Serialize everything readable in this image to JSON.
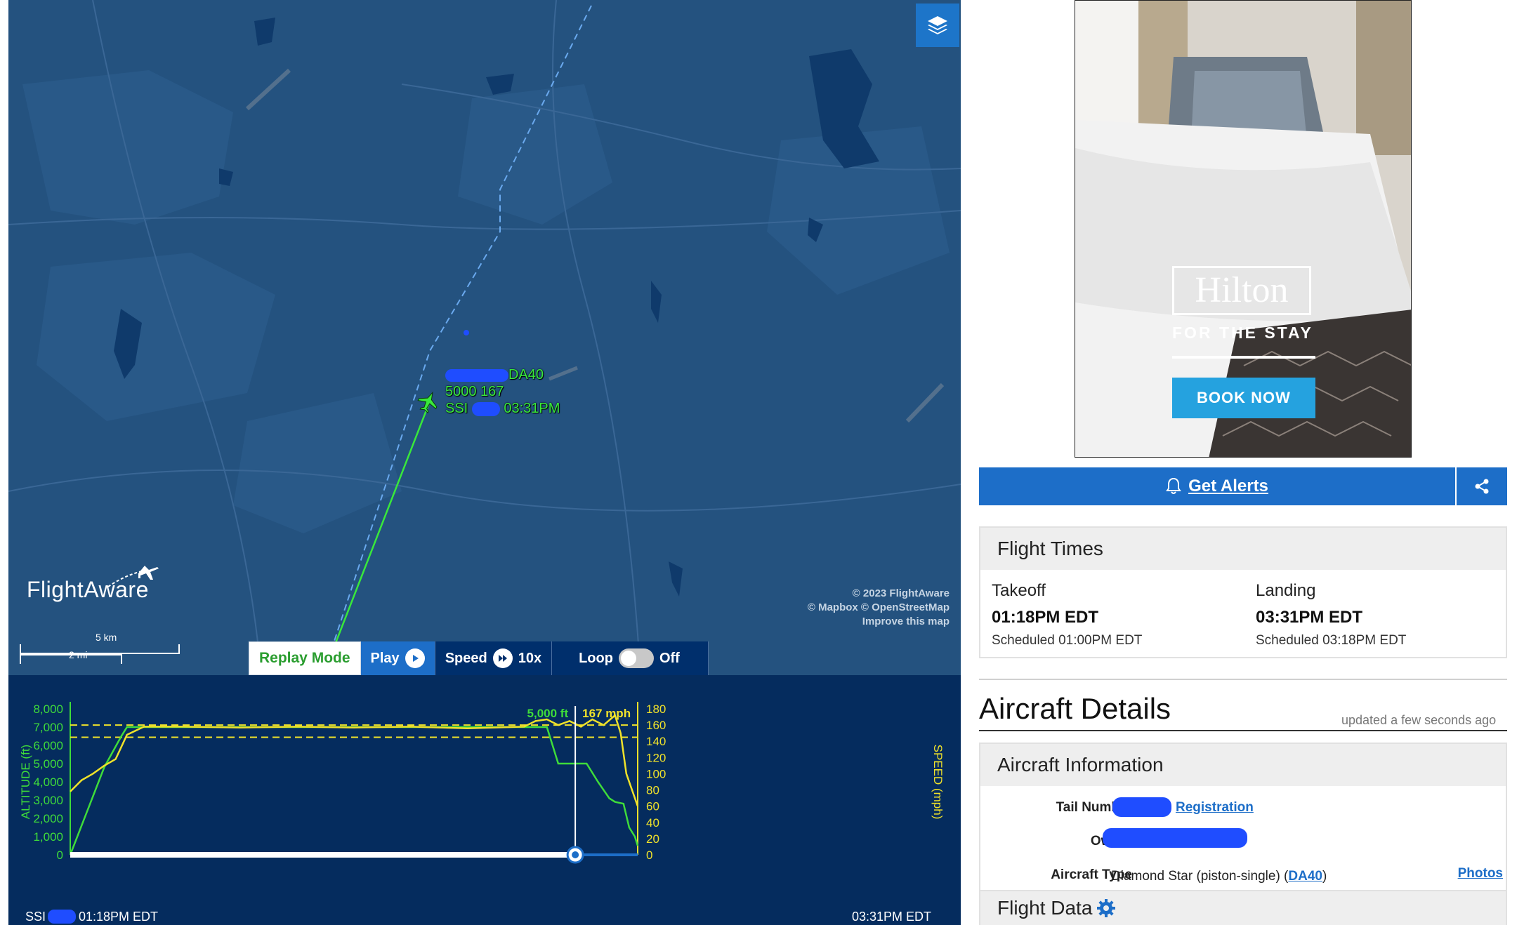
{
  "map": {
    "flight_label": {
      "line1_suffix": "DA40",
      "line2": "5000 167",
      "line3_prefix": "SSI",
      "line3_suffix": "03:31PM"
    },
    "logo_text": "FlightAware",
    "attribution": [
      "© 2023 FlightAware",
      "© Mapbox © OpenStreetMap",
      "Improve this map"
    ],
    "scale": {
      "km": "5 km",
      "mi": "2 mi"
    }
  },
  "replay": {
    "mode_label": "Replay Mode",
    "play_label": "Play",
    "speed_label": "Speed",
    "speed_value": "10x",
    "loop_label": "Loop",
    "loop_state": "Off"
  },
  "chart_data": {
    "type": "line",
    "readout_altitude": "5,000 ft",
    "readout_speed": "167 mph",
    "y_left_label": "ALTITUDE (ft)",
    "y_right_label": "SPEED (mph)",
    "y_left_ticks": [
      "8,000",
      "7,000",
      "6,000",
      "5,000",
      "4,000",
      "3,000",
      "2,000",
      "1,000",
      "0"
    ],
    "y_right_ticks": [
      "180",
      "160",
      "140",
      "120",
      "100",
      "80",
      "60",
      "40",
      "20",
      "0"
    ],
    "ylim_altitude": [
      0,
      8000
    ],
    "ylim_speed": [
      0,
      180
    ],
    "x_start_label_prefix": "SSI",
    "x_start_time": "01:18PM EDT",
    "x_end_time": "03:31PM EDT",
    "playhead_progress": 0.89,
    "series": [
      {
        "color": "#3fdc3a",
        "x": [
          0,
          0.03,
          0.06,
          0.09,
          0.1,
          0.84,
          0.86,
          0.88,
          0.91,
          0.93,
          0.95,
          0.96,
          0.975,
          0.985,
          0.995,
          1.0
        ],
        "values": [
          0,
          2400,
          4800,
          6500,
          7000,
          7000,
          5000,
          5000,
          5000,
          4000,
          3100,
          2900,
          2800,
          1500,
          1000,
          500
        ]
      },
      {
        "color": "#f0e22a",
        "x": [
          0,
          0.02,
          0.04,
          0.06,
          0.08,
          0.1,
          0.13,
          0.2,
          0.3,
          0.4,
          0.5,
          0.6,
          0.7,
          0.8,
          0.82,
          0.84,
          0.86,
          0.88,
          0.9,
          0.92,
          0.94,
          0.96,
          0.97,
          0.98,
          0.99,
          1.0
        ],
        "values": [
          78,
          92,
          100,
          110,
          118,
          148,
          158,
          158,
          157,
          158,
          157,
          158,
          156,
          158,
          165,
          167,
          160,
          165,
          158,
          167,
          160,
          172,
          150,
          100,
          80,
          60
        ]
      }
    ],
    "reference_lines": [
      160,
      145
    ]
  },
  "ad": {
    "brand": "Hilton",
    "tagline": "FOR THE STAY",
    "cta": "BOOK NOW"
  },
  "actions": {
    "alerts_label": "Get Alerts"
  },
  "flight_times": {
    "title": "Flight Times",
    "takeoff_label": "Takeoff",
    "takeoff_time": "01:18PM EDT",
    "takeoff_scheduled": "Scheduled 01:00PM EDT",
    "landing_label": "Landing",
    "landing_time": "03:31PM EDT",
    "landing_scheduled": "Scheduled 03:18PM EDT"
  },
  "aircraft_details": {
    "title": "Aircraft Details",
    "updated": "updated a few seconds ago",
    "info_title": "Aircraft Information",
    "tail_label": "Tail Number",
    "registration_link": "Registration",
    "owner_label": "Owner",
    "type_label": "Aircraft Type",
    "type_value": "Diamond Star (piston-single) (",
    "type_link": "DA40",
    "type_close": ")",
    "photos_link": "Photos"
  },
  "flight_data": {
    "title": "Flight Data"
  },
  "colors": {
    "map_bg": "#24527f",
    "chart_bg": "#052c5e",
    "altitude": "#3fdc3a",
    "speed": "#f0e22a",
    "accent": "#1d6ec8"
  }
}
